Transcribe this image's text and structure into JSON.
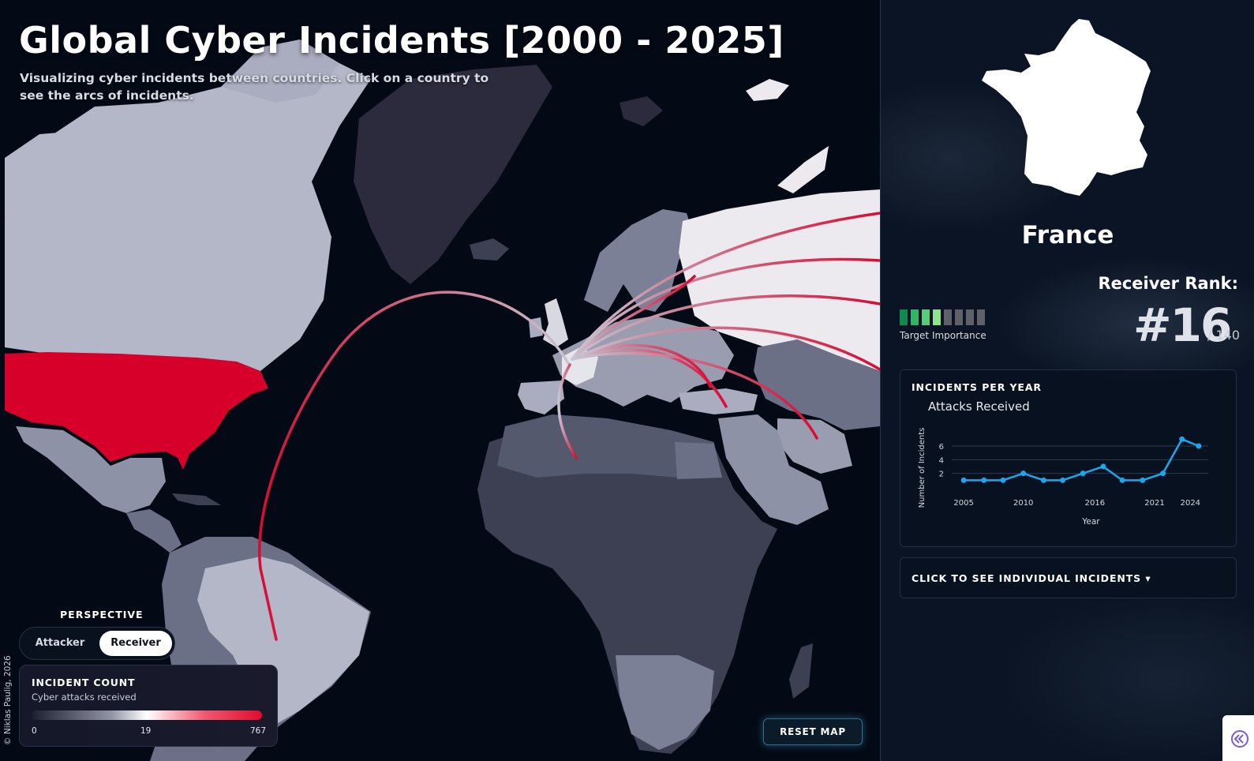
{
  "header": {
    "title": "Global Cyber Incidents [2000 - 2025]",
    "subtitle": "Visualizing cyber incidents between countries. Click on a country to see the arcs of incidents."
  },
  "perspective": {
    "label": "PERSPECTIVE",
    "options": [
      "Attacker",
      "Receiver"
    ],
    "selected": "Receiver"
  },
  "legend": {
    "title": "INCIDENT COUNT",
    "subtitle": "Cyber attacks received",
    "min": "0",
    "mid": "19",
    "max": "767"
  },
  "credit": "© Niklas Paulig, 2026",
  "reset_label": "RESET MAP",
  "panel": {
    "country": "France",
    "rank_label": "Receiver Rank:",
    "rank_value": "#16",
    "rank_total": "/ 140",
    "importance_label": "Target Importance",
    "importance_level": 4,
    "importance_max": 8,
    "chart_card_title": "INCIDENTS PER YEAR",
    "incidents_toggle": "CLICK TO SEE INDIVIDUAL INCIDENTS ▾"
  },
  "colors": {
    "selected_country": "#d7002a",
    "arc_strong": "#d80b33",
    "arc_light": "#c9c4d2",
    "chart_line": "#1aa7ec",
    "importance_active": [
      "#0f8a4f",
      "#2fb565",
      "#58cc76",
      "#8fe38f"
    ],
    "importance_inactive": "#5e6268"
  },
  "icons": {
    "collapse": "double-chevron-left-icon"
  },
  "chart_data": {
    "type": "line",
    "title": "Attacks Received",
    "xlabel": "Year",
    "ylabel": "Number of Incidents",
    "x_ticks": [
      2005,
      2010,
      2016,
      2021,
      2024
    ],
    "y_ticks": [
      2,
      4,
      6
    ],
    "xlim": [
      2004,
      2025.5
    ],
    "ylim": [
      0,
      7.5
    ],
    "grid": true,
    "series": [
      {
        "x": [
          2005,
          2006.7,
          2008.3,
          2010,
          2011.7,
          2013.3,
          2015,
          2016.7,
          2018.3,
          2020,
          2021.7,
          2023.3,
          2024.7
        ],
        "y": [
          1,
          1,
          1,
          2,
          1,
          1,
          2,
          3,
          1,
          1,
          2,
          7,
          6
        ]
      }
    ]
  }
}
